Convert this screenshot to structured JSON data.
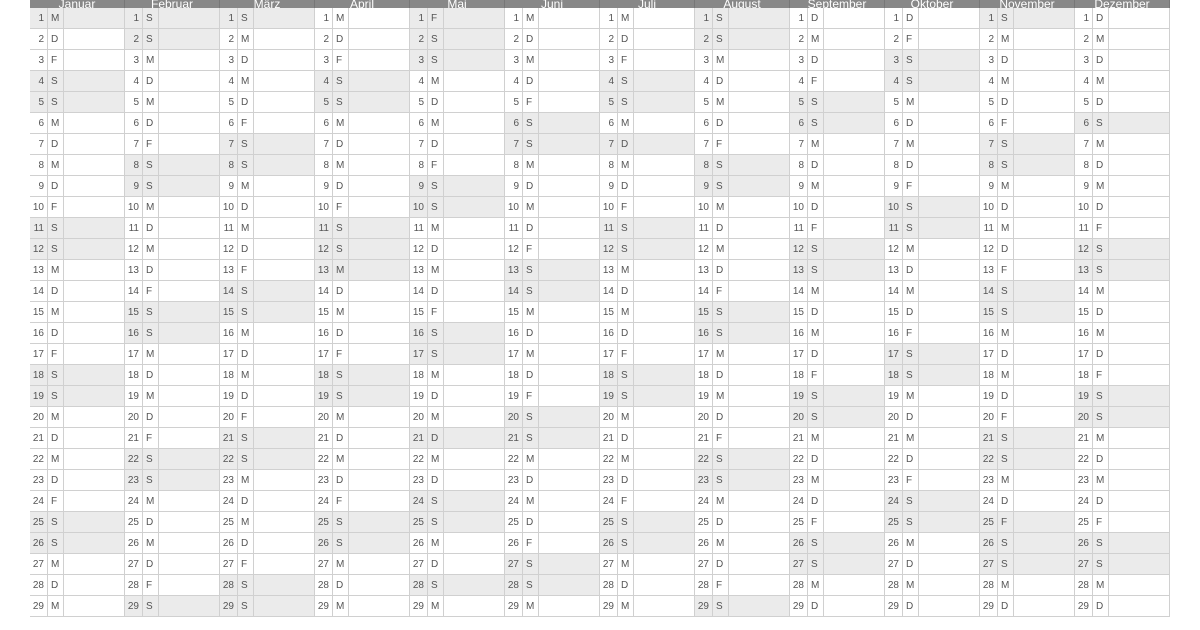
{
  "months": [
    {
      "name": "Januar",
      "days": [
        "M",
        "D",
        "F",
        "S",
        "S",
        "M",
        "D",
        "M",
        "D",
        "F",
        "S",
        "S",
        "M",
        "D",
        "M",
        "D",
        "F",
        "S",
        "S",
        "M",
        "D",
        "M",
        "D",
        "F",
        "S",
        "S",
        "M",
        "D",
        "M"
      ]
    },
    {
      "name": "Februar",
      "days": [
        "S",
        "S",
        "M",
        "D",
        "M",
        "D",
        "F",
        "S",
        "S",
        "M",
        "D",
        "M",
        "D",
        "F",
        "S",
        "S",
        "M",
        "D",
        "M",
        "D",
        "F",
        "S",
        "S",
        "M",
        "D",
        "M",
        "D",
        "F",
        "S"
      ]
    },
    {
      "name": "März",
      "days": [
        "S",
        "M",
        "D",
        "M",
        "D",
        "F",
        "S",
        "S",
        "M",
        "D",
        "M",
        "D",
        "F",
        "S",
        "S",
        "M",
        "D",
        "M",
        "D",
        "F",
        "S",
        "S",
        "M",
        "D",
        "M",
        "D",
        "F",
        "S",
        "S"
      ]
    },
    {
      "name": "April",
      "days": [
        "M",
        "D",
        "F",
        "S",
        "S",
        "M",
        "D",
        "M",
        "D",
        "F",
        "S",
        "S",
        "M",
        "D",
        "M",
        "D",
        "F",
        "S",
        "S",
        "M",
        "D",
        "M",
        "D",
        "F",
        "S",
        "S",
        "M",
        "D",
        "M"
      ]
    },
    {
      "name": "Mai",
      "days": [
        "F",
        "S",
        "S",
        "M",
        "D",
        "M",
        "D",
        "F",
        "S",
        "S",
        "M",
        "D",
        "M",
        "D",
        "F",
        "S",
        "S",
        "M",
        "D",
        "M",
        "D",
        "M",
        "D",
        "S",
        "S",
        "M",
        "D",
        "S",
        "M"
      ]
    },
    {
      "name": "Juni",
      "days": [
        "M",
        "D",
        "M",
        "D",
        "F",
        "S",
        "S",
        "M",
        "D",
        "M",
        "D",
        "F",
        "S",
        "S",
        "M",
        "D",
        "M",
        "D",
        "F",
        "S",
        "S",
        "M",
        "D",
        "M",
        "D",
        "F",
        "S",
        "S",
        "M"
      ]
    },
    {
      "name": "Juli",
      "days": [
        "M",
        "D",
        "F",
        "S",
        "S",
        "M",
        "D",
        "M",
        "D",
        "F",
        "S",
        "S",
        "M",
        "D",
        "M",
        "D",
        "F",
        "S",
        "S",
        "M",
        "D",
        "M",
        "D",
        "F",
        "S",
        "S",
        "M",
        "D",
        "M"
      ]
    },
    {
      "name": "August",
      "days": [
        "S",
        "S",
        "M",
        "D",
        "M",
        "D",
        "F",
        "S",
        "S",
        "M",
        "D",
        "M",
        "D",
        "F",
        "S",
        "S",
        "M",
        "D",
        "M",
        "D",
        "F",
        "S",
        "S",
        "M",
        "D",
        "M",
        "D",
        "F",
        "S"
      ]
    },
    {
      "name": "September",
      "days": [
        "D",
        "M",
        "D",
        "F",
        "S",
        "S",
        "M",
        "D",
        "M",
        "D",
        "F",
        "S",
        "S",
        "M",
        "D",
        "M",
        "D",
        "F",
        "S",
        "S",
        "M",
        "D",
        "M",
        "D",
        "F",
        "S",
        "S",
        "M",
        "D"
      ]
    },
    {
      "name": "Oktober",
      "days": [
        "D",
        "F",
        "S",
        "S",
        "M",
        "D",
        "M",
        "D",
        "F",
        "S",
        "S",
        "M",
        "D",
        "M",
        "D",
        "F",
        "S",
        "S",
        "M",
        "D",
        "M",
        "D",
        "F",
        "S",
        "S",
        "M",
        "D",
        "M",
        "D"
      ]
    },
    {
      "name": "November",
      "days": [
        "S",
        "M",
        "D",
        "M",
        "D",
        "F",
        "S",
        "S",
        "M",
        "D",
        "M",
        "D",
        "F",
        "S",
        "S",
        "M",
        "D",
        "M",
        "D",
        "F",
        "S",
        "S",
        "M",
        "D",
        "F",
        "S",
        "S",
        "M",
        "D"
      ]
    },
    {
      "name": "Dezember",
      "days": [
        "D",
        "M",
        "D",
        "M",
        "D",
        "S",
        "M",
        "D",
        "M",
        "D",
        "F",
        "S",
        "S",
        "M",
        "D",
        "M",
        "D",
        "F",
        "S",
        "S",
        "M",
        "D",
        "M",
        "D",
        "F",
        "S",
        "S",
        "M",
        "D"
      ]
    }
  ],
  "special_shade": {
    "0": [
      0
    ],
    "3": [
      12
    ],
    "4": [
      0,
      20
    ],
    "6": [
      6
    ],
    "10": [
      24
    ]
  },
  "weekend_letter": "S"
}
